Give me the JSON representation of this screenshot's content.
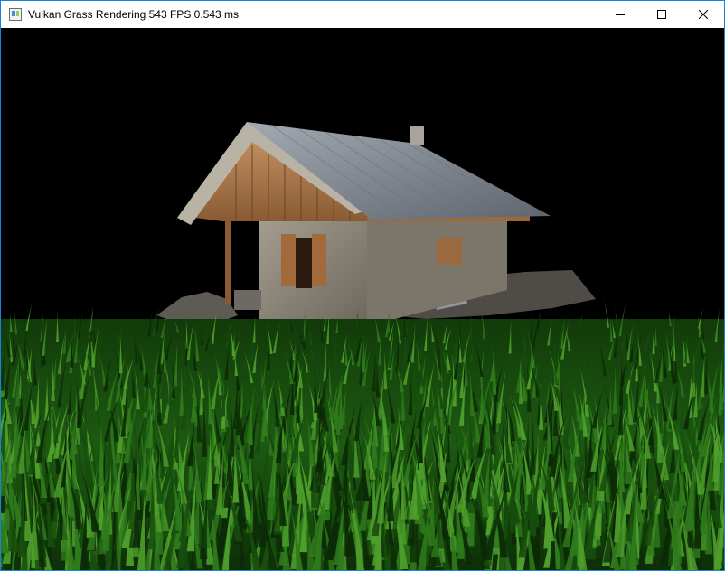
{
  "window": {
    "title": "Vulkan Grass Rendering 543 FPS 0.543 ms",
    "app_icon": "application-icon",
    "controls": [
      {
        "name": "minimize",
        "icon": "minimize-icon"
      },
      {
        "name": "maximize",
        "icon": "maximize-icon"
      },
      {
        "name": "close",
        "icon": "close-icon"
      }
    ],
    "border_color": "#1883d7"
  },
  "scene": {
    "background_color": "#000000",
    "grass_colors": [
      "#0b2a06",
      "#174d0d",
      "#2f7a1c",
      "#4f9e2c"
    ],
    "roof_color": "#8a9099",
    "stone_color": "#8d867a",
    "wood_color": "#8a5a34"
  }
}
